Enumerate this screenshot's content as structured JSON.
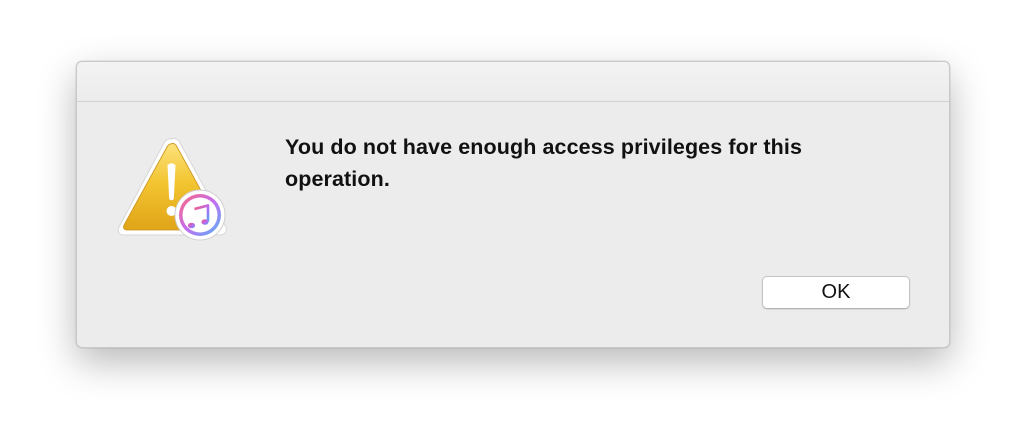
{
  "dialog": {
    "message": "You do not have enough access privileges for this operation.",
    "ok_label": "OK",
    "icons": {
      "warning": "warning-triangle-icon",
      "badge": "itunes-music-note-icon"
    }
  },
  "colors": {
    "dialog_background": "#ececec",
    "warning_yellow": "#f2c230",
    "itunes_gradient_start": "#fb5c74",
    "itunes_gradient_end": "#5ac8fa"
  }
}
